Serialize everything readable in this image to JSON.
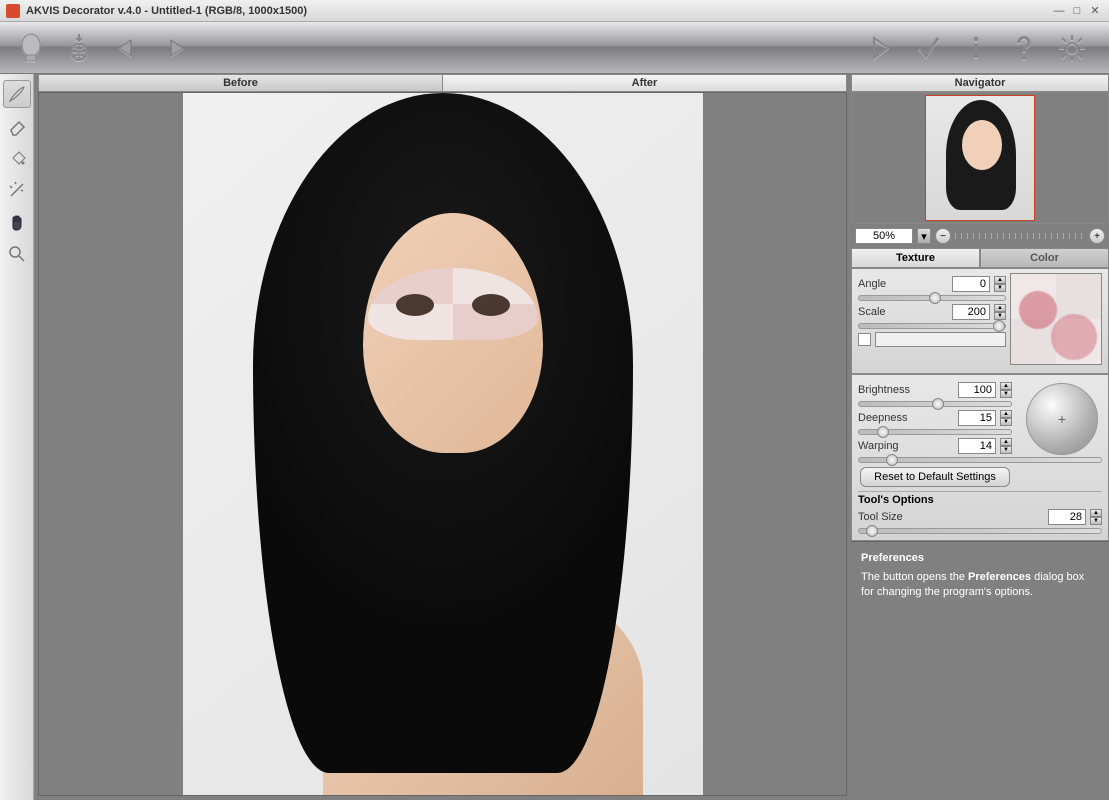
{
  "title": "AKVIS Decorator v.4.0 - Untitled-1 (RGB/8, 1000x1500)",
  "tabs": {
    "before": "Before",
    "after": "After"
  },
  "navigator": {
    "title": "Navigator",
    "zoom": "50%"
  },
  "subtabs": {
    "texture": "Texture",
    "color": "Color"
  },
  "params": {
    "angle_label": "Angle",
    "angle": "0",
    "scale_label": "Scale",
    "scale": "200",
    "brightness_label": "Brightness",
    "brightness": "100",
    "deepness_label": "Deepness",
    "deepness": "15",
    "warping_label": "Warping",
    "warping": "14",
    "reset": "Reset to Default Settings",
    "tools_head": "Tool's Options",
    "toolsize_label": "Tool Size",
    "toolsize": "28"
  },
  "help": {
    "title": "Preferences",
    "body_pre": "The button opens the ",
    "body_bold": "Preferences",
    "body_post": " dialog box for changing the program's options."
  }
}
